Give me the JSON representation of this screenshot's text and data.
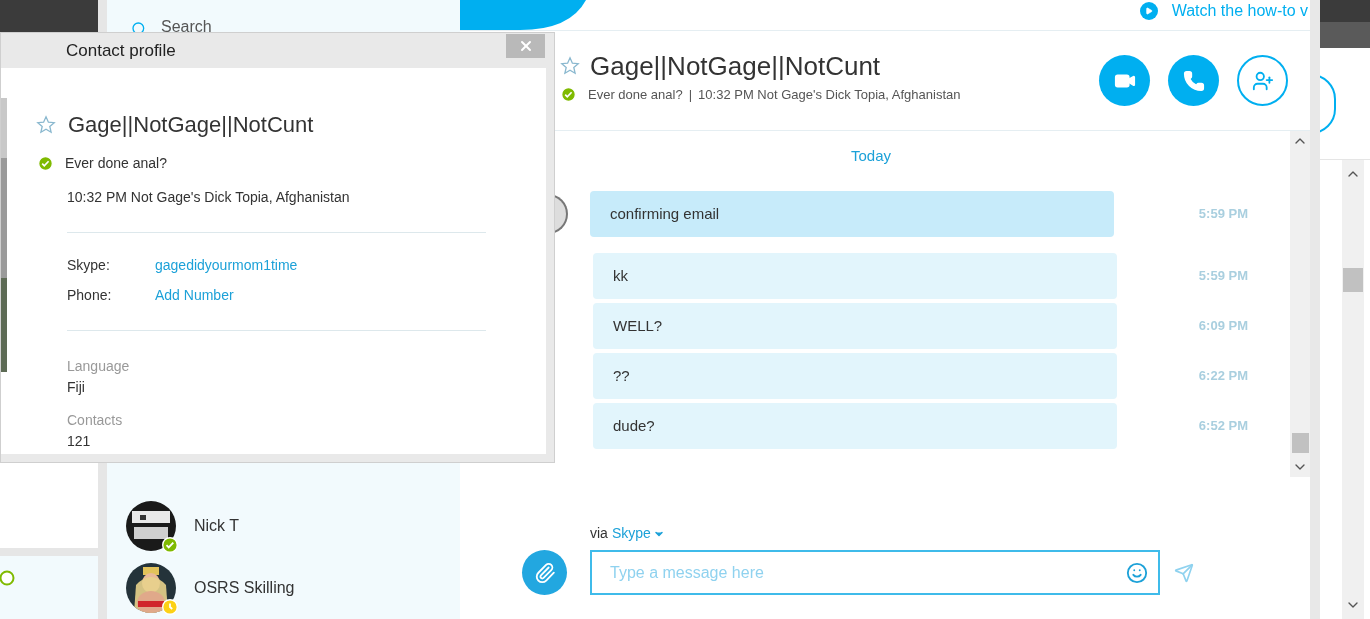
{
  "background_window": {
    "search": {
      "placeholder": "Search"
    },
    "help_link": "Watch the how-to v",
    "contacts": [
      {
        "name": "Nick T",
        "away": false
      },
      {
        "name": "OSRS Skilling",
        "away": true
      }
    ]
  },
  "chat": {
    "title": "Gage||NotGage||NotCunt",
    "favorite": false,
    "online": true,
    "mood": "Ever done anal?",
    "separator": "|",
    "location": "10:32 PM Not Gage's Dick Topia, Afghanistan",
    "date": "Today",
    "messages": [
      {
        "kind": "incoming",
        "text": "confirming email",
        "time": "5:59 PM"
      },
      {
        "kind": "outgoing",
        "text": "kk",
        "time": "5:59 PM"
      },
      {
        "kind": "outgoing",
        "text": "WELL?",
        "time": "6:09 PM"
      },
      {
        "kind": "outgoing",
        "text": "??",
        "time": "6:22 PM"
      },
      {
        "kind": "outgoing",
        "text": "dude?",
        "time": "6:52 PM"
      }
    ],
    "via_label": "via",
    "via_service": "Skype",
    "message_placeholder": "Type a message here"
  },
  "profile_dialog": {
    "title": "Contact profile",
    "name": "Gage||NotGage||NotCunt",
    "favorite": false,
    "online": true,
    "mood": "Ever done anal?",
    "location": "10:32 PM Not Gage's Dick Topia, Afghanistan",
    "skype_label": "Skype:",
    "skype_id": "gagedidyourmom1time",
    "phone_label": "Phone:",
    "phone_action": "Add Number",
    "language_label": "Language",
    "language": "Fiji",
    "contacts_label": "Contacts",
    "contacts": "121"
  }
}
